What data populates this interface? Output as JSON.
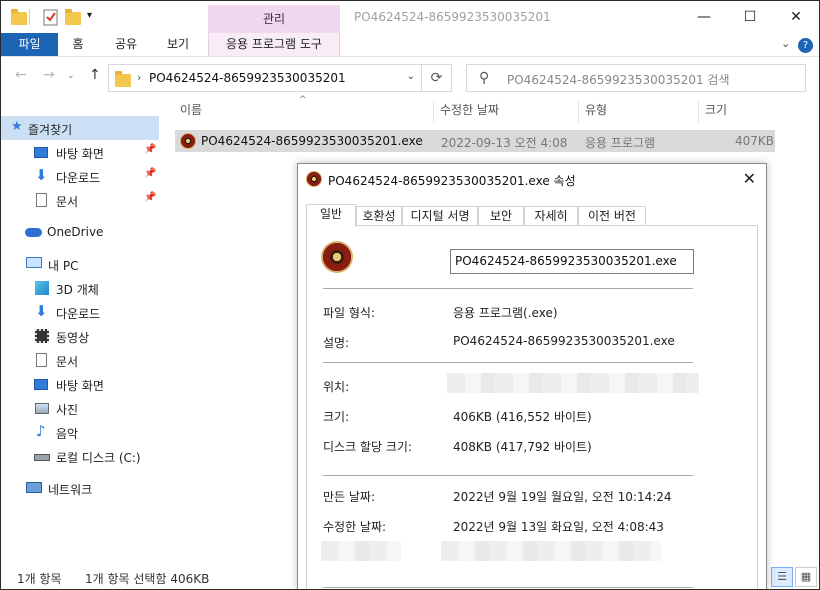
{
  "window": {
    "title": "PO4624524-8659923530035201",
    "context_tab": "관리",
    "controls": {
      "minimize": "—",
      "maximize": "☐",
      "close": "✕"
    }
  },
  "ribbon": {
    "tabs": [
      "파일",
      "홈",
      "공유",
      "보기",
      "응용 프로그램 도구"
    ],
    "collapse": "⌄",
    "help": "?"
  },
  "address": {
    "path": "PO4624524-8659923530035201",
    "search_placeholder": "PO4624524-8659923530035201 검색"
  },
  "sidebar": {
    "items": [
      {
        "label": "즐겨찾기",
        "icon": "star-icon"
      },
      {
        "label": "바탕 화면",
        "icon": "desktop-icon"
      },
      {
        "label": "다운로드",
        "icon": "download-icon"
      },
      {
        "label": "문서",
        "icon": "document-icon"
      },
      {
        "label": "OneDrive",
        "icon": "cloud-icon"
      },
      {
        "label": "내 PC",
        "icon": "pc-icon"
      },
      {
        "label": "3D 개체",
        "icon": "cube-icon"
      },
      {
        "label": "다운로드",
        "icon": "download-icon"
      },
      {
        "label": "동영상",
        "icon": "video-icon"
      },
      {
        "label": "문서",
        "icon": "document-icon"
      },
      {
        "label": "바탕 화면",
        "icon": "desktop-icon"
      },
      {
        "label": "사진",
        "icon": "picture-icon"
      },
      {
        "label": "음악",
        "icon": "music-icon"
      },
      {
        "label": "로컬 디스크 (C:)",
        "icon": "disk-icon"
      },
      {
        "label": "네트워크",
        "icon": "network-icon"
      }
    ]
  },
  "filelist": {
    "columns": [
      "이름",
      "수정한 날짜",
      "유형",
      "크기"
    ],
    "rows": [
      {
        "name": "PO4624524-8659923530035201.exe",
        "modified": "2022-09-13 오전 4:08",
        "type": "응용 프로그램",
        "size": "407KB"
      }
    ]
  },
  "status": {
    "count": "1개 항목",
    "selected": "1개 항목 선택함 406KB"
  },
  "dialog": {
    "title": "PO4624524-8659923530035201.exe 속성",
    "close": "✕",
    "tabs": [
      "일반",
      "호환성",
      "디지털 서명",
      "보안",
      "자세히",
      "이전 버전"
    ],
    "filename": "PO4624524-8659923530035201.exe",
    "props": {
      "type_label": "파일 형식:",
      "type_value": "응용 프로그램(.exe)",
      "desc_label": "설명:",
      "desc_value": "PO4624524-8659923530035201.exe",
      "loc_label": "위치:",
      "size_label": "크기:",
      "size_value": "406KB (416,552 바이트)",
      "disk_label": "디스크 할당 크기:",
      "disk_value": "408KB (417,792 바이트)",
      "created_label": "만든 날짜:",
      "created_value": "2022년 9월 19일 월요일, 오전 10:14:24",
      "modified_label": "수정한 날짜:",
      "modified_value": "2022년 9월 13일 화요일, 오전 4:08:43"
    }
  }
}
